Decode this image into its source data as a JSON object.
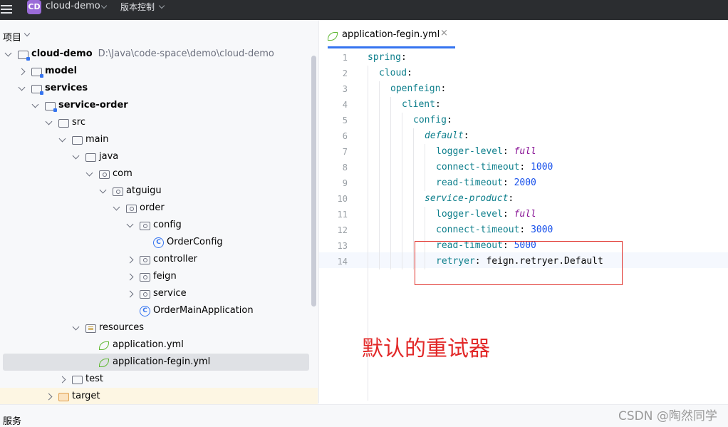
{
  "titlebar": {
    "project_badge": "CD",
    "project_name": "cloud-demo",
    "vcs_label": "版本控制"
  },
  "project_panel": {
    "title": "项目",
    "tree": [
      {
        "label": "cloud-demo",
        "path": "D:\\Java\\code-space\\demo\\cloud-demo",
        "depth": 0,
        "expanded": true,
        "icon": "module-folder-icon",
        "bold": true
      },
      {
        "label": "model",
        "depth": 1,
        "expanded": false,
        "icon": "module-folder-icon",
        "bold": true
      },
      {
        "label": "services",
        "depth": 1,
        "expanded": true,
        "icon": "module-folder-icon",
        "bold": true
      },
      {
        "label": "service-order",
        "depth": 2,
        "expanded": true,
        "icon": "module-folder-icon",
        "bold": true
      },
      {
        "label": "src",
        "depth": 3,
        "expanded": true,
        "icon": "folder-icon"
      },
      {
        "label": "main",
        "depth": 4,
        "expanded": true,
        "icon": "folder-icon"
      },
      {
        "label": "java",
        "depth": 5,
        "expanded": true,
        "icon": "source-folder-icon"
      },
      {
        "label": "com",
        "depth": 6,
        "expanded": true,
        "icon": "package-icon"
      },
      {
        "label": "atguigu",
        "depth": 7,
        "expanded": true,
        "icon": "package-icon"
      },
      {
        "label": "order",
        "depth": 8,
        "expanded": true,
        "icon": "package-icon"
      },
      {
        "label": "config",
        "depth": 9,
        "expanded": true,
        "icon": "package-icon"
      },
      {
        "label": "OrderConfig",
        "depth": 10,
        "icon": "class-icon"
      },
      {
        "label": "controller",
        "depth": 9,
        "expanded": false,
        "icon": "package-icon"
      },
      {
        "label": "feign",
        "depth": 9,
        "expanded": false,
        "icon": "package-icon"
      },
      {
        "label": "service",
        "depth": 9,
        "expanded": false,
        "icon": "package-icon"
      },
      {
        "label": "OrderMainApplication",
        "depth": 9,
        "icon": "spring-boot-class-icon"
      },
      {
        "label": "resources",
        "depth": 5,
        "expanded": true,
        "icon": "resources-folder-icon"
      },
      {
        "label": "application.yml",
        "depth": 6,
        "icon": "spring-yaml-icon"
      },
      {
        "label": "application-fegin.yml",
        "depth": 6,
        "icon": "spring-yaml-icon",
        "selected": true
      },
      {
        "label": "test",
        "depth": 4,
        "expanded": false,
        "icon": "folder-icon"
      },
      {
        "label": "target",
        "depth": 3,
        "expanded": false,
        "icon": "excluded-folder-icon",
        "highlight": true
      }
    ]
  },
  "editor": {
    "tab_label": "application-fegin.yml",
    "tab_close": "×",
    "lines": [
      {
        "n": "1",
        "indent": 0,
        "key": "spring",
        "italic": false,
        "sep": ":",
        "value": "",
        "value_type": ""
      },
      {
        "n": "2",
        "indent": 1,
        "key": "cloud",
        "italic": false,
        "sep": ":",
        "value": "",
        "value_type": ""
      },
      {
        "n": "3",
        "indent": 2,
        "key": "openfeign",
        "italic": false,
        "sep": ":",
        "value": "",
        "value_type": ""
      },
      {
        "n": "4",
        "indent": 3,
        "key": "client",
        "italic": false,
        "sep": ":",
        "value": "",
        "value_type": ""
      },
      {
        "n": "5",
        "indent": 4,
        "key": "config",
        "italic": false,
        "sep": ":",
        "value": "",
        "value_type": ""
      },
      {
        "n": "6",
        "indent": 5,
        "key": "default",
        "italic": true,
        "sep": ":",
        "value": "",
        "value_type": ""
      },
      {
        "n": "7",
        "indent": 6,
        "key": "logger-level",
        "italic": false,
        "sep": ": ",
        "value": "full",
        "value_type": "enum"
      },
      {
        "n": "8",
        "indent": 6,
        "key": "connect-timeout",
        "italic": false,
        "sep": ": ",
        "value": "1000",
        "value_type": "number"
      },
      {
        "n": "9",
        "indent": 6,
        "key": "read-timeout",
        "italic": false,
        "sep": ": ",
        "value": "2000",
        "value_type": "number"
      },
      {
        "n": "10",
        "indent": 5,
        "key": "service-product",
        "italic": true,
        "sep": ":",
        "value": "",
        "value_type": ""
      },
      {
        "n": "11",
        "indent": 6,
        "key": "logger-level",
        "italic": false,
        "sep": ": ",
        "value": "full",
        "value_type": "enum"
      },
      {
        "n": "12",
        "indent": 6,
        "key": "connect-timeout",
        "italic": false,
        "sep": ": ",
        "value": "3000",
        "value_type": "number"
      },
      {
        "n": "13",
        "indent": 6,
        "key": "read-timeout",
        "italic": false,
        "sep": ": ",
        "value": "5000",
        "value_type": "number"
      },
      {
        "n": "14",
        "indent": 6,
        "key": "retryer",
        "italic": false,
        "sep": ": ",
        "value": "feign.retryer.Default",
        "value_type": "plain"
      }
    ],
    "annotation": "默认的重试器",
    "annotation_color": "#e22828"
  },
  "bottom_panel": {
    "title": "服务"
  },
  "watermark": "CSDN @陶然同学",
  "colors": {
    "accent": "#3574f0",
    "yaml_key": "#0e7f8c",
    "yaml_number": "#1750eb",
    "yaml_enum": "#871094",
    "highlight_box": "#e0302a"
  }
}
